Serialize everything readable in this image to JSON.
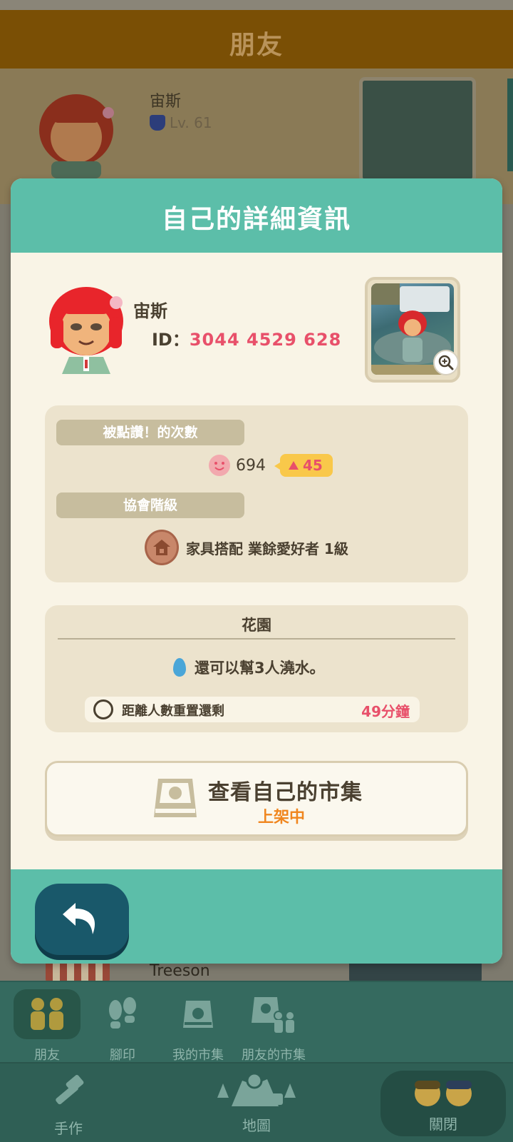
{
  "background": {
    "header_title": "朋友",
    "friend_name": "宙斯",
    "friend_level": "Lv. 61",
    "next_friend_name": "Treeson"
  },
  "modal": {
    "title": "自己的詳細資訊",
    "profile": {
      "name": "宙斯",
      "id_label": "ID：",
      "id_value": "3044 4529 628"
    },
    "likes_section": {
      "label": "被點讚！的次數",
      "count": "694",
      "delta": "45"
    },
    "rank_section": {
      "label": "協會階級",
      "value": "家具搭配 業餘愛好者 1級"
    },
    "garden": {
      "title": "花園",
      "water_text": "還可以幫3人澆水。",
      "reset_label": "距離人數重置還剩",
      "reset_time": "49分鐘"
    },
    "market_button": {
      "title": "查看自己的市集",
      "status": "上架中"
    }
  },
  "nav_top": {
    "items": [
      {
        "label": "朋友",
        "icon": "friends-icon",
        "active": true
      },
      {
        "label": "腳印",
        "icon": "footprint-icon",
        "active": false
      },
      {
        "label": "我的市集",
        "icon": "market-icon",
        "active": false
      },
      {
        "label": "朋友的市集",
        "icon": "friend-market-icon",
        "active": false
      }
    ]
  },
  "nav_bottom": {
    "craft_label": "手作",
    "map_label": "地圖",
    "close_label": "關閉"
  },
  "colors": {
    "teal": "#5cbea9",
    "cream": "#f9f4e6",
    "accent_pink": "#e8506a",
    "accent_orange": "#f0861e",
    "back_button": "#19586a"
  }
}
